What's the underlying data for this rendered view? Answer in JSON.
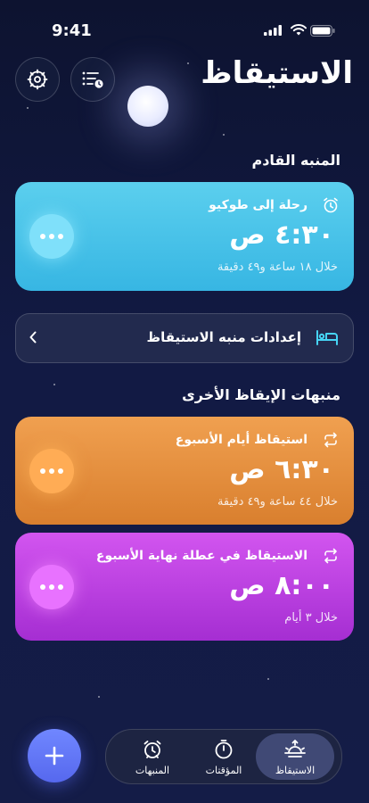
{
  "status_bar": {
    "time": "9:41"
  },
  "header": {
    "title": "الاستيقاظ"
  },
  "sections": {
    "next_alarm": "المنبه القادم",
    "other_alarms": "منبهات الإيقاظ الأخرى"
  },
  "alarms": [
    {
      "name": "رحلة إلى طوكيو",
      "time": "٤:٣٠ ص",
      "remaining": "خلال ١٨ ساعة و٤٩ دقيقة",
      "icon": "alarm-clock-icon",
      "color": "#3fbce6"
    },
    {
      "name": "استيقاظ أيام الأسبوع",
      "time": "٦:٣٠ ص",
      "remaining": "خلال ٤٤ ساعة و٤٩ دقيقة",
      "icon": "repeat-icon",
      "color": "#e48a38"
    },
    {
      "name": "الاستيقاظ في عطلة نهاية الأسبوع",
      "time": "٨:٠٠ ص",
      "remaining": "خلال ٣ أيام",
      "icon": "repeat-icon",
      "color": "#b83ce0"
    }
  ],
  "settings_row": {
    "label": "إعدادات منبه الاستيقاظ",
    "icon": "bed-icon"
  },
  "tabs": [
    {
      "label": "الاستيقاظ",
      "icon": "sunrise-icon",
      "active": true
    },
    {
      "label": "المؤقتات",
      "icon": "timer-icon",
      "active": false
    },
    {
      "label": "المنبهات",
      "icon": "alarm-clock-icon",
      "active": false
    }
  ],
  "fab": {
    "icon": "plus-icon"
  }
}
